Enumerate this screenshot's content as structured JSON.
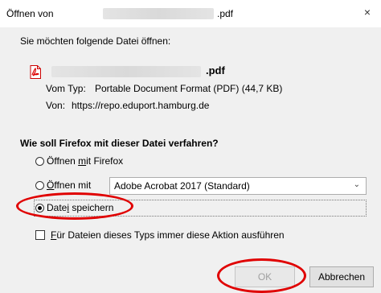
{
  "title": {
    "prefix": "Öffnen von",
    "suffix": ".pdf",
    "close_symbol": "×"
  },
  "intro": "Sie möchten folgende Datei öffnen:",
  "file": {
    "extension": ".pdf",
    "type_label": "Vom Typ:",
    "type_value": "Portable Document Format (PDF) (44,7 KB)",
    "from_label": "Von:",
    "from_value": "https://repo.eduport.hamburg.de",
    "icon": "pdf-file-icon"
  },
  "question": "Wie soll Firefox mit dieser Datei verfahren?",
  "options": {
    "open_firefox": {
      "pre": "Öffnen ",
      "mnemonic": "m",
      "post": "it Firefox"
    },
    "open_with": {
      "mnemonic": "Ö",
      "post": "ffnen mit"
    },
    "open_with_app": "Adobe Acrobat 2017 (Standard)",
    "save": {
      "pre": "Date",
      "mnemonic": "i",
      "post": " speichern"
    },
    "selected": "save"
  },
  "remember": {
    "mnemonic": "F",
    "post": "ür Dateien dieses Typs immer diese Aktion ausführen",
    "checked": false
  },
  "buttons": {
    "ok": "OK",
    "cancel": "Abbrechen"
  },
  "colors": {
    "annotation": "#e00000",
    "background": "#f0f0f0"
  }
}
